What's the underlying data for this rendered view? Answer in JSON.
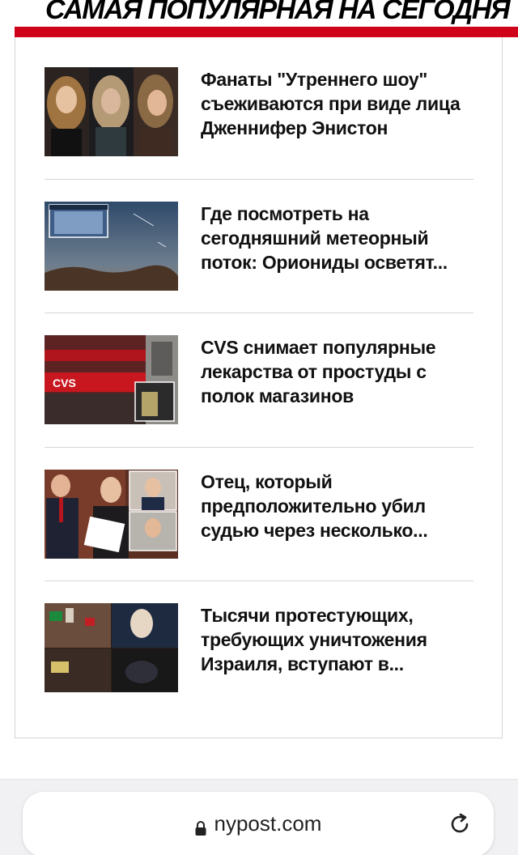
{
  "section": {
    "title": "САМАЯ ПОПУЛЯРНАЯ НА СЕГОДНЯ"
  },
  "articles": [
    {
      "headline": "Фанаты \"Утреннего шоу\" съеживаются при виде лица Дженнифер Энистон"
    },
    {
      "headline": "Где посмотреть на сегодняшний метеорный поток: Ориониды осветят..."
    },
    {
      "headline": "CVS снимает популярные лекарства от простуды с полок магазинов"
    },
    {
      "headline": "Отец, который предположительно убил судью через несколько..."
    },
    {
      "headline": "Тысячи протестующих, требующих уничтожения Израиля, вступают в..."
    }
  ],
  "browser": {
    "url": "nypost.com"
  },
  "colors": {
    "accent_red": "#d0021b"
  },
  "icons": {
    "lock": "lock-icon",
    "reload": "reload-icon"
  }
}
